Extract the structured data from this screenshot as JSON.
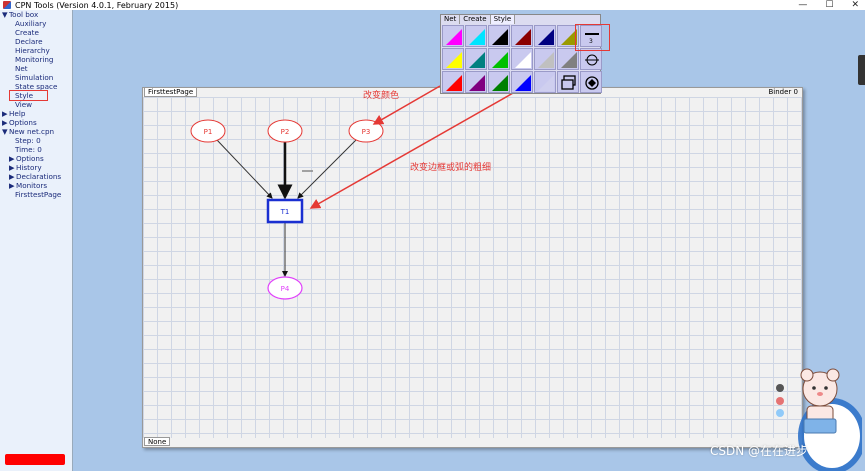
{
  "window": {
    "title": "CPN Tools (Version 4.0.1, February 2015)",
    "minimize": "—",
    "maximize": "☐",
    "close": "✕"
  },
  "tree": [
    {
      "label": "Tool box",
      "level": 0,
      "expanded": true
    },
    {
      "label": "Auxiliary",
      "level": 1
    },
    {
      "label": "Create",
      "level": 1
    },
    {
      "label": "Declare",
      "level": 1
    },
    {
      "label": "Hierarchy",
      "level": 1
    },
    {
      "label": "Monitoring",
      "level": 1
    },
    {
      "label": "Net",
      "level": 1
    },
    {
      "label": "Simulation",
      "level": 1
    },
    {
      "label": "State space",
      "level": 1
    },
    {
      "label": "Style",
      "level": 1,
      "highlighted": true
    },
    {
      "label": "View",
      "level": 1
    },
    {
      "label": "Help",
      "level": 0,
      "expanded": false
    },
    {
      "label": "Options",
      "level": 0,
      "expanded": false
    },
    {
      "label": "New net.cpn",
      "level": 0,
      "expanded": true
    },
    {
      "label": "Step: 0",
      "level": 1
    },
    {
      "label": "Time: 0",
      "level": 1
    },
    {
      "label": "Options",
      "level": "1c",
      "expanded": false
    },
    {
      "label": "History",
      "level": "1c",
      "expanded": false
    },
    {
      "label": "Declarations",
      "level": "1c",
      "expanded": false
    },
    {
      "label": "Monitors",
      "level": "1c",
      "expanded": false
    },
    {
      "label": "FirsttestPage",
      "level": 1
    }
  ],
  "binder": {
    "page_tab": "FirsttestPage",
    "label": "Binder 0",
    "bottom_tab": "None"
  },
  "palette": {
    "tabs": [
      "Net",
      "Create",
      "Style"
    ],
    "active_tab": "Style",
    "rows": [
      [
        "#ff00ff",
        "#00e5ff",
        "#000000",
        "#8b0000",
        "#000080",
        "#9a9a00",
        "line-width"
      ],
      [
        "#ffff00",
        "#008080",
        "#00c000",
        "#ffffff",
        "#c0c0c0",
        "#808080",
        "arc-style"
      ],
      [
        "#ff0000",
        "#800080",
        "#008000",
        "#0000ff",
        "#cfcfef",
        "window",
        "circle-tool"
      ]
    ],
    "line_width_value": "3"
  },
  "net": {
    "places": [
      {
        "id": "P1",
        "label": "P1",
        "color": "#e53935"
      },
      {
        "id": "P2",
        "label": "P2",
        "color": "#e53935"
      },
      {
        "id": "P3",
        "label": "P3",
        "color": "#e53935"
      },
      {
        "id": "P4",
        "label": "P4",
        "color": "#e040fb"
      }
    ],
    "transition": {
      "id": "T1",
      "label": "T1",
      "color": "#1a2fd1"
    }
  },
  "annotations": {
    "change_color": "改变颜色",
    "change_width": "改变边框或弧的粗细"
  },
  "watermark": "CSDN @在在进步"
}
